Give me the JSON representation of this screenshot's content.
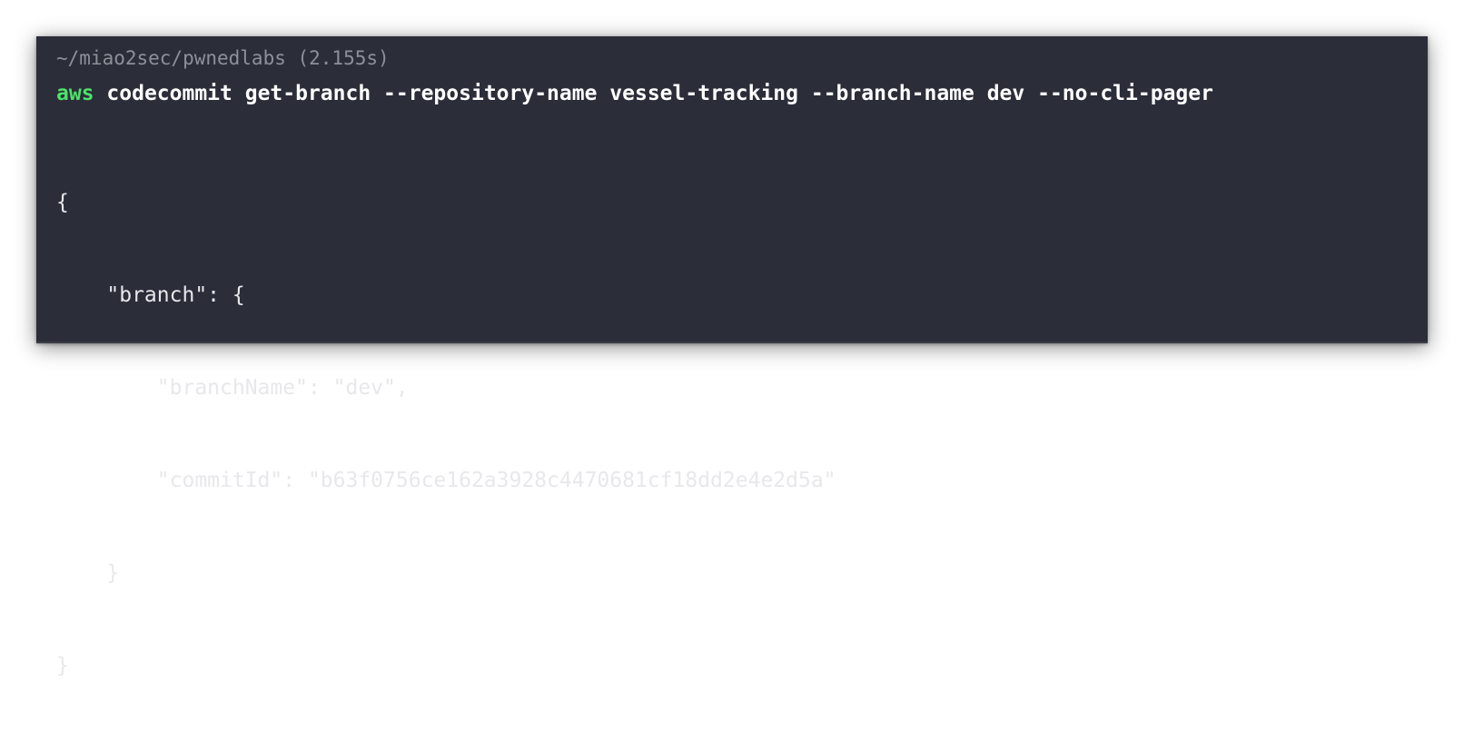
{
  "terminal": {
    "header": "~/miao2sec/pwnedlabs (2.155s)",
    "command": {
      "program": "aws",
      "args": "codecommit get-branch --repository-name vessel-tracking --branch-name dev --no-cli-pager"
    },
    "output_lines": [
      "{",
      "    \"branch\": {",
      "        \"branchName\": \"dev\",",
      "        \"commitId\": \"b63f0756ce162a3928c4470681cf18dd2e4e2d5a\"",
      "    }",
      "}"
    ]
  },
  "colors": {
    "background": "#2b2d39",
    "header_text": "#8e9099",
    "command_program": "#4ee06a",
    "command_args": "#ffffff",
    "output_text": "#e8e8ec"
  }
}
